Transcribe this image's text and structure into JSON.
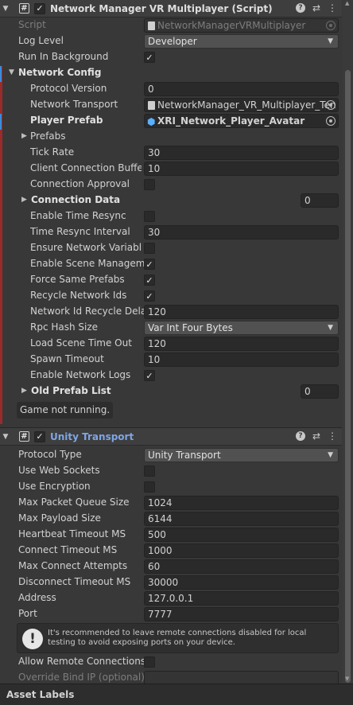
{
  "network_manager": {
    "title": "Network Manager VR Multiplayer (Script)",
    "enabled": true,
    "script": {
      "label": "Script",
      "value": "NetworkManagerVRMultiplayer"
    },
    "log_level": {
      "label": "Log Level",
      "value": "Developer"
    },
    "run_in_background": {
      "label": "Run In Background",
      "checked": true
    },
    "network_config": {
      "label": "Network Config"
    },
    "protocol_version": {
      "label": "Protocol Version",
      "value": "0"
    },
    "network_transport": {
      "label": "Network Transport",
      "value": "NetworkManager_VR_Multiplayer_Ten"
    },
    "player_prefab": {
      "label": "Player Prefab",
      "value": "XRI_Network_Player_Avatar"
    },
    "prefabs": {
      "label": "Prefabs"
    },
    "tick_rate": {
      "label": "Tick Rate",
      "value": "30"
    },
    "client_connection_buffer": {
      "label": "Client Connection Buffer",
      "value": "10"
    },
    "connection_approval": {
      "label": "Connection Approval",
      "checked": false
    },
    "connection_data": {
      "label": "Connection Data",
      "value": "0"
    },
    "enable_time_resync": {
      "label": "Enable Time Resync",
      "checked": false
    },
    "time_resync_interval": {
      "label": "Time Resync Interval",
      "value": "30"
    },
    "ensure_network_variable": {
      "label": "Ensure Network Variable",
      "checked": false
    },
    "enable_scene_management": {
      "label": "Enable Scene Manageme",
      "checked": true
    },
    "force_same_prefabs": {
      "label": "Force Same Prefabs",
      "checked": true
    },
    "recycle_network_ids": {
      "label": "Recycle Network Ids",
      "checked": true
    },
    "network_id_recycle_delay": {
      "label": "Network Id Recycle Delay",
      "value": "120"
    },
    "rpc_hash_size": {
      "label": "Rpc Hash Size",
      "value": "Var Int Four Bytes"
    },
    "load_scene_time_out": {
      "label": "Load Scene Time Out",
      "value": "120"
    },
    "spawn_timeout": {
      "label": "Spawn Timeout",
      "value": "10"
    },
    "enable_network_logs": {
      "label": "Enable Network Logs",
      "checked": true
    },
    "old_prefab_list": {
      "label": "Old Prefab List",
      "value": "0"
    },
    "status": "Game not running."
  },
  "unity_transport": {
    "title": "Unity Transport",
    "enabled": true,
    "protocol_type": {
      "label": "Protocol Type",
      "value": "Unity Transport"
    },
    "use_web_sockets": {
      "label": "Use Web Sockets",
      "checked": false
    },
    "use_encryption": {
      "label": "Use Encryption",
      "checked": false
    },
    "max_packet_queue_size": {
      "label": "Max Packet Queue Size",
      "value": "1024"
    },
    "max_payload_size": {
      "label": "Max Payload Size",
      "value": "6144"
    },
    "heartbeat_timeout": {
      "label": "Heartbeat Timeout MS",
      "value": "500"
    },
    "connect_timeout": {
      "label": "Connect Timeout MS",
      "value": "1000"
    },
    "max_connect_attempts": {
      "label": "Max Connect Attempts",
      "value": "60"
    },
    "disconnect_timeout": {
      "label": "Disconnect Timeout MS",
      "value": "30000"
    },
    "address": {
      "label": "Address",
      "value": "127.0.0.1"
    },
    "port": {
      "label": "Port",
      "value": "7777"
    },
    "help_message": "It's recommended to leave remote connections disabled for local testing to avoid exposing ports on your device.",
    "allow_remote_connections": {
      "label": "Allow Remote Connections?",
      "checked": false
    },
    "override_bind_ip": {
      "label": "Override Bind IP (optional)",
      "value": ""
    }
  },
  "footer": {
    "label": "Asset Labels"
  },
  "glyphs": {
    "hash": "#",
    "check": "✓",
    "help": "?",
    "sliders": "⇄",
    "menu": "⋮",
    "arrow_right": "▶",
    "arrow_down": "▼",
    "dd_arrow": "▼",
    "warn": "!",
    "cube": "⬢",
    "up": "▲",
    "down": "▼"
  }
}
